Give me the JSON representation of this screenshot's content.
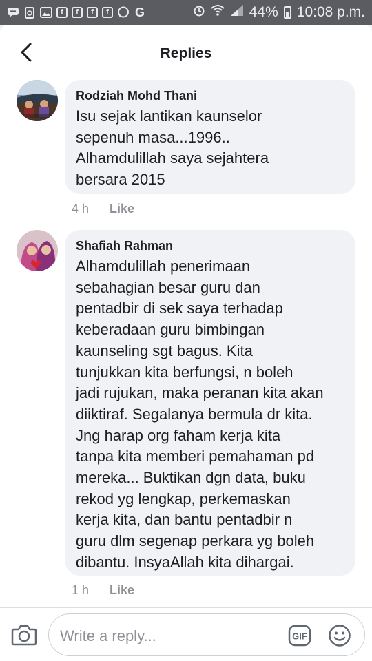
{
  "status_bar": {
    "battery": "44%",
    "time": "10:08 p.m.",
    "icons": [
      "chat-icon",
      "recycle-icon",
      "image-icon",
      "facebook-icon",
      "facebook-icon",
      "facebook-icon",
      "facebook-icon",
      "whatsapp-icon",
      "google-icon",
      "alarm-icon",
      "wifi-icon",
      "signal-icon",
      "battery-icon"
    ]
  },
  "header": {
    "title": "Replies"
  },
  "replies": [
    {
      "author": "Rodziah Mohd Thani",
      "text": "Isu sejak lantikan kaunselor\nsepenuh masa...1996..\nAlhamdulillah saya sejahtera\nbersara 2015",
      "time": "4 h",
      "like_label": "Like"
    },
    {
      "author": "Shafiah Rahman",
      "text": "Alhamdulillah penerimaan\nsebahagian besar guru dan\npentadbir di sek saya terhadap\nkeberadaan guru bimbingan\nkaunseling sgt bagus. Kita\ntunjukkan kita berfungsi, n boleh\njadi rujukan, maka peranan kita akan\ndiiktiraf. Segalanya bermula dr kita.\nJng harap org faham kerja kita\ntanpa kita memberi pemahaman pd\nmereka... Buktikan dgn data, buku\nrekod yg lengkap, perkemaskan\nkerja kita, dan bantu pentadbir n\nguru dlm segenap perkara yg boleh\ndibantu. InsyaAllah kita dihargai.",
      "time": "1 h",
      "like_label": "Like"
    }
  ],
  "composer": {
    "placeholder": "Write a reply...",
    "gif_label": "GIF"
  },
  "colors": {
    "status_bar": "#5a5c61",
    "bubble": "#f0f2f5",
    "meta_text": "#8e9196"
  }
}
